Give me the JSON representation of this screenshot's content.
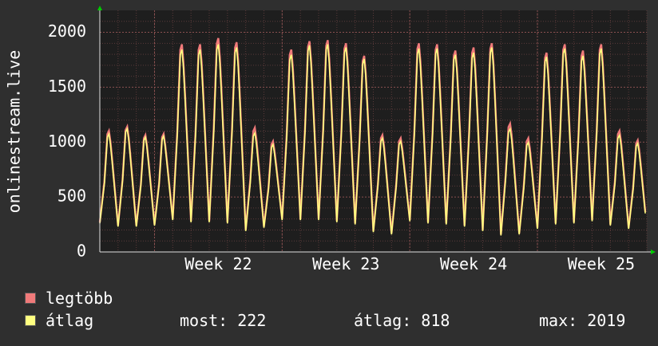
{
  "chart_data": {
    "type": "line",
    "ylabel": "onlinestream.live",
    "ylim": [
      0,
      2200
    ],
    "y_ticks": [
      0,
      500,
      1000,
      1500,
      2000
    ],
    "x_ticks": [
      "Week 22",
      "Week 23",
      "Week 24",
      "Week 25"
    ],
    "grid": true,
    "background": "#1e1e1e",
    "series": [
      {
        "name": "legtöbb",
        "color": "#f07a7a",
        "daily_peaks": [
          1160,
          1200,
          1120,
          1130,
          1990,
          1990,
          2050,
          2010,
          1190,
          1060,
          1940,
          2020,
          2030,
          2000,
          1880,
          1120,
          1090,
          2000,
          1990,
          1930,
          1960,
          2000,
          1230,
          1090,
          1910,
          1990,
          1930,
          1990,
          1160,
          1070
        ],
        "daily_troughs": [
          270,
          240,
          240,
          250,
          300,
          280,
          280,
          270,
          200,
          230,
          300,
          300,
          300,
          280,
          260,
          190,
          170,
          290,
          270,
          260,
          240,
          200,
          160,
          170,
          220,
          260,
          270,
          290,
          250,
          220
        ]
      },
      {
        "name": "átlag",
        "color": "#ffff80",
        "daily_peaks": [
          1130,
          1180,
          1100,
          1110,
          1940,
          1940,
          1990,
          1960,
          1140,
          1030,
          1890,
          1980,
          1990,
          1960,
          1850,
          1090,
          1060,
          1950,
          1950,
          1890,
          1910,
          1960,
          1180,
          1050,
          1870,
          1950,
          1880,
          1950,
          1120,
          1040
        ],
        "daily_troughs": [
          260,
          230,
          230,
          240,
          290,
          270,
          270,
          260,
          190,
          220,
          290,
          290,
          290,
          270,
          250,
          180,
          160,
          280,
          260,
          250,
          230,
          190,
          150,
          160,
          210,
          250,
          260,
          280,
          240,
          210
        ]
      }
    ]
  },
  "legend": [
    {
      "label": "legtöbb",
      "color": "#f07a7a"
    },
    {
      "label": "átlag",
      "color": "#ffff80"
    }
  ],
  "stats": {
    "most": "most: 222",
    "atlag": "átlag: 818",
    "max": "max: 2019"
  }
}
